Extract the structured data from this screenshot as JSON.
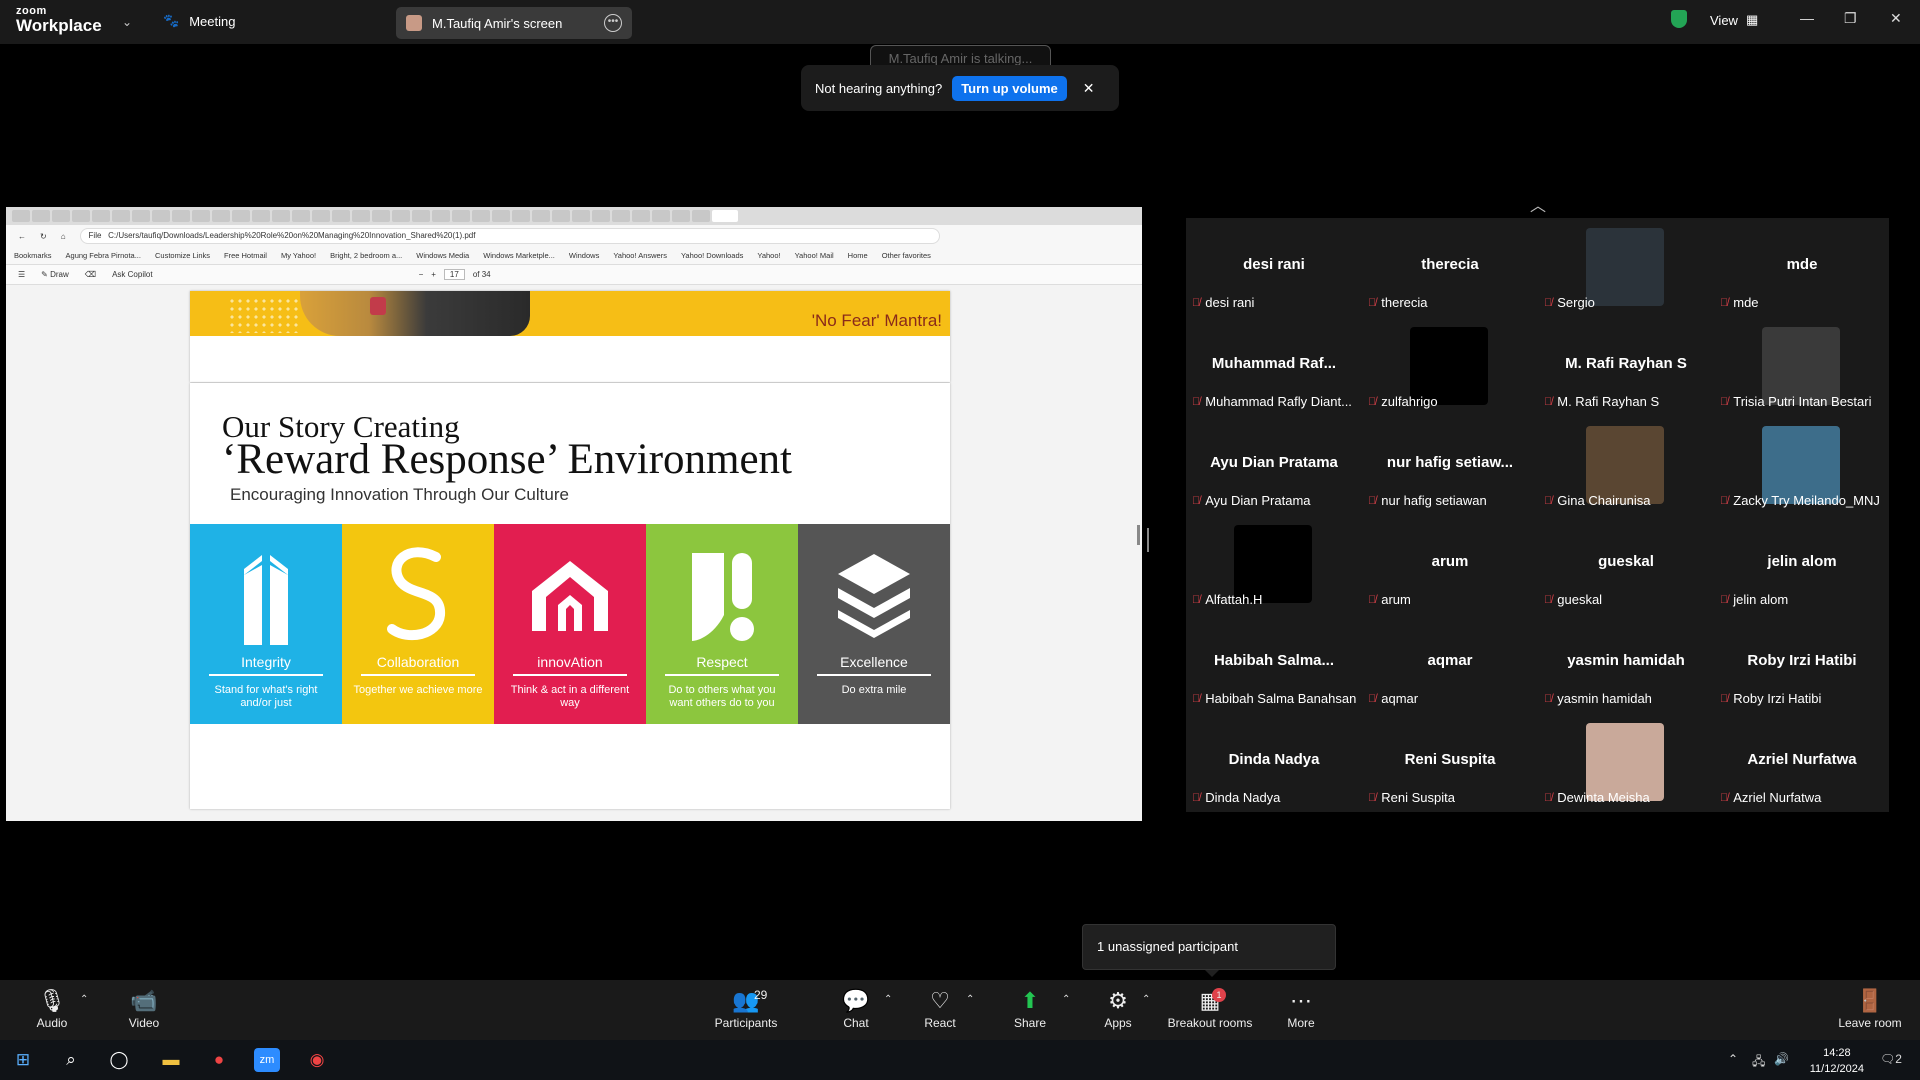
{
  "app": {
    "brand_top": "zoom",
    "brand_bottom": "Workplace",
    "meeting_label": "Meeting"
  },
  "share_pill": {
    "label": "M.Taufiq Amir's screen"
  },
  "view_label": "View",
  "talking": "M.Taufiq Amir is talking...",
  "toast": {
    "text": "Not hearing anything?",
    "button": "Turn up volume",
    "close": "✕"
  },
  "browser": {
    "url": "C:/Users/taufiq/Downloads/Leadership%20Role%20on%20Managing%20Innovation_Shared%20(1).pdf",
    "file_label": "File",
    "bookmarks": [
      "Bookmarks",
      "Agung Febra Pirnota...",
      "Customize Links",
      "Free Hotmail",
      "My Yahoo!",
      "Bright, 2 bedroom a...",
      "Windows Media",
      "Windows Marketple...",
      "Windows",
      "Yahoo! Answers",
      "Yahoo! Downloads",
      "Yahoo!",
      "Yahoo! Mail",
      "Home",
      "Other favorites"
    ],
    "pdf_tools": {
      "draw": "Draw",
      "copilot": "Ask Copilot",
      "page": "17",
      "of": "of 34"
    }
  },
  "slide_top": {
    "mantra": "'No Fear' Mantra!"
  },
  "slide": {
    "title1": "Our Story Creating",
    "title2": "‘Reward Response’ Environment",
    "subtitle": "Encouraging Innovation Through Our Culture",
    "values": [
      {
        "name": "Integrity",
        "desc": "Stand for what's right and/or just",
        "color": "#1fb2e6"
      },
      {
        "name": "Collaboration",
        "desc": "Together we achieve more",
        "color": "#f3c60f"
      },
      {
        "name": "innovAtion",
        "desc": "Think & act in a different way",
        "color": "#e21e50"
      },
      {
        "name": "Respect",
        "desc": "Do to others what you want others do to you",
        "color": "#8cc63e"
      },
      {
        "name": "Excellence",
        "desc": "Do extra mile",
        "color": "#555555"
      }
    ]
  },
  "participants": [
    {
      "big": "desi rani",
      "label": "desi rani"
    },
    {
      "big": "therecia",
      "label": "therecia"
    },
    {
      "big": "",
      "label": "Sergio",
      "pic": "#2b333a"
    },
    {
      "big": "mde",
      "label": "mde"
    },
    {
      "big": "Muhammad  Raf...",
      "label": "Muhammad Rafly Diant..."
    },
    {
      "big": "",
      "label": "zulfahrigo",
      "pic": "#000000"
    },
    {
      "big": "M. Rafi Rayhan S",
      "label": "M. Rafi Rayhan S"
    },
    {
      "big": "",
      "label": "Trisia Putri Intan Bestari",
      "pic": "#3a3a3a"
    },
    {
      "big": "Ayu Dian Pratama",
      "label": "Ayu Dian Pratama"
    },
    {
      "big": "nur hafig setiaw...",
      "label": "nur hafig setiawan"
    },
    {
      "big": "",
      "label": "Gina Chairunisa",
      "pic": "#5a4632"
    },
    {
      "big": "",
      "label": "Zacky Try Meilando_MNJ",
      "pic": "#3d6d8a"
    },
    {
      "big": "",
      "label": "Alfattah.H",
      "pic": "#000000"
    },
    {
      "big": "arum",
      "label": "arum"
    },
    {
      "big": "gueskal",
      "label": "gueskal"
    },
    {
      "big": "jelin alom",
      "label": "jelin alom"
    },
    {
      "big": "Habibah  Salma...",
      "label": "Habibah Salma Banahsan"
    },
    {
      "big": "aqmar",
      "label": "aqmar"
    },
    {
      "big": "yasmin hamidah",
      "label": "yasmin hamidah"
    },
    {
      "big": "Roby Irzi Hatibi",
      "label": "Roby Irzi Hatibi"
    },
    {
      "big": "Dinda Nadya",
      "label": "Dinda Nadya"
    },
    {
      "big": "Reni Suspita",
      "label": "Reni Suspita"
    },
    {
      "big": "",
      "label": "Dewinta Meisha",
      "pic": "#c9a99a"
    },
    {
      "big": "Azriel Nurfatwa",
      "label": "Azriel Nurfatwa"
    }
  ],
  "unassigned": "1 unassigned participant",
  "toolbar": {
    "audio": "Audio",
    "video": "Video",
    "participants": "Participants",
    "participants_count": "29",
    "chat": "Chat",
    "react": "React",
    "share": "Share",
    "apps": "Apps",
    "breakout": "Breakout rooms",
    "breakout_badge": "1",
    "more": "More",
    "leave": "Leave room"
  },
  "taskbar": {
    "time": "14:28",
    "date": "11/12/2024",
    "notif": "2"
  }
}
